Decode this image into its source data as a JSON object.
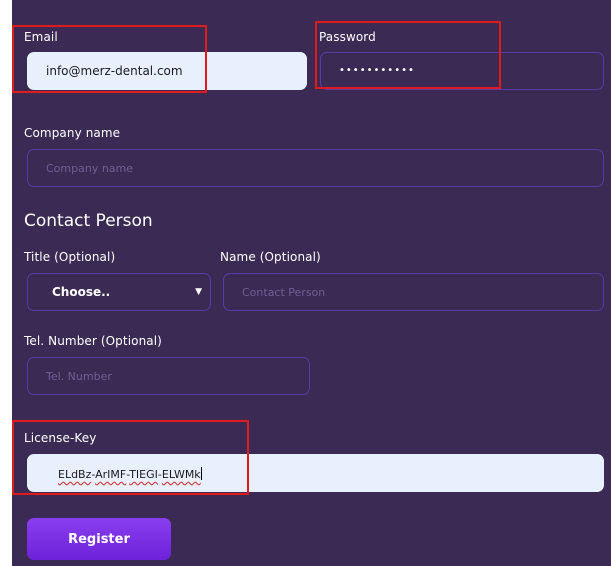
{
  "form": {
    "email": {
      "label": "Email",
      "value": "info@merz-dental.com"
    },
    "password": {
      "label": "Password",
      "masked_value": "•••••••••••"
    },
    "company_name": {
      "label": "Company name",
      "placeholder": "Company name"
    },
    "contact_person": {
      "heading": "Contact Person",
      "title": {
        "label": "Title (Optional)",
        "selected": "Choose..",
        "caret_icon": "caret-down-icon"
      },
      "name": {
        "label": "Name (Optional)",
        "placeholder": "Contact Person"
      },
      "tel": {
        "label": "Tel. Number (Optional)",
        "placeholder": "Tel. Number"
      }
    },
    "license_key": {
      "label": "License-Key",
      "parts": [
        "ELdBz",
        "ArIMF",
        "TIEGI",
        "ELWMk"
      ],
      "separator": "-"
    },
    "register_label": "Register"
  },
  "colors": {
    "background": "#3b2a54",
    "field_border": "#5a3aa6",
    "filled_field": "#e9f0fd",
    "button": "#7a2fe6",
    "highlight": "#e01b1b"
  }
}
